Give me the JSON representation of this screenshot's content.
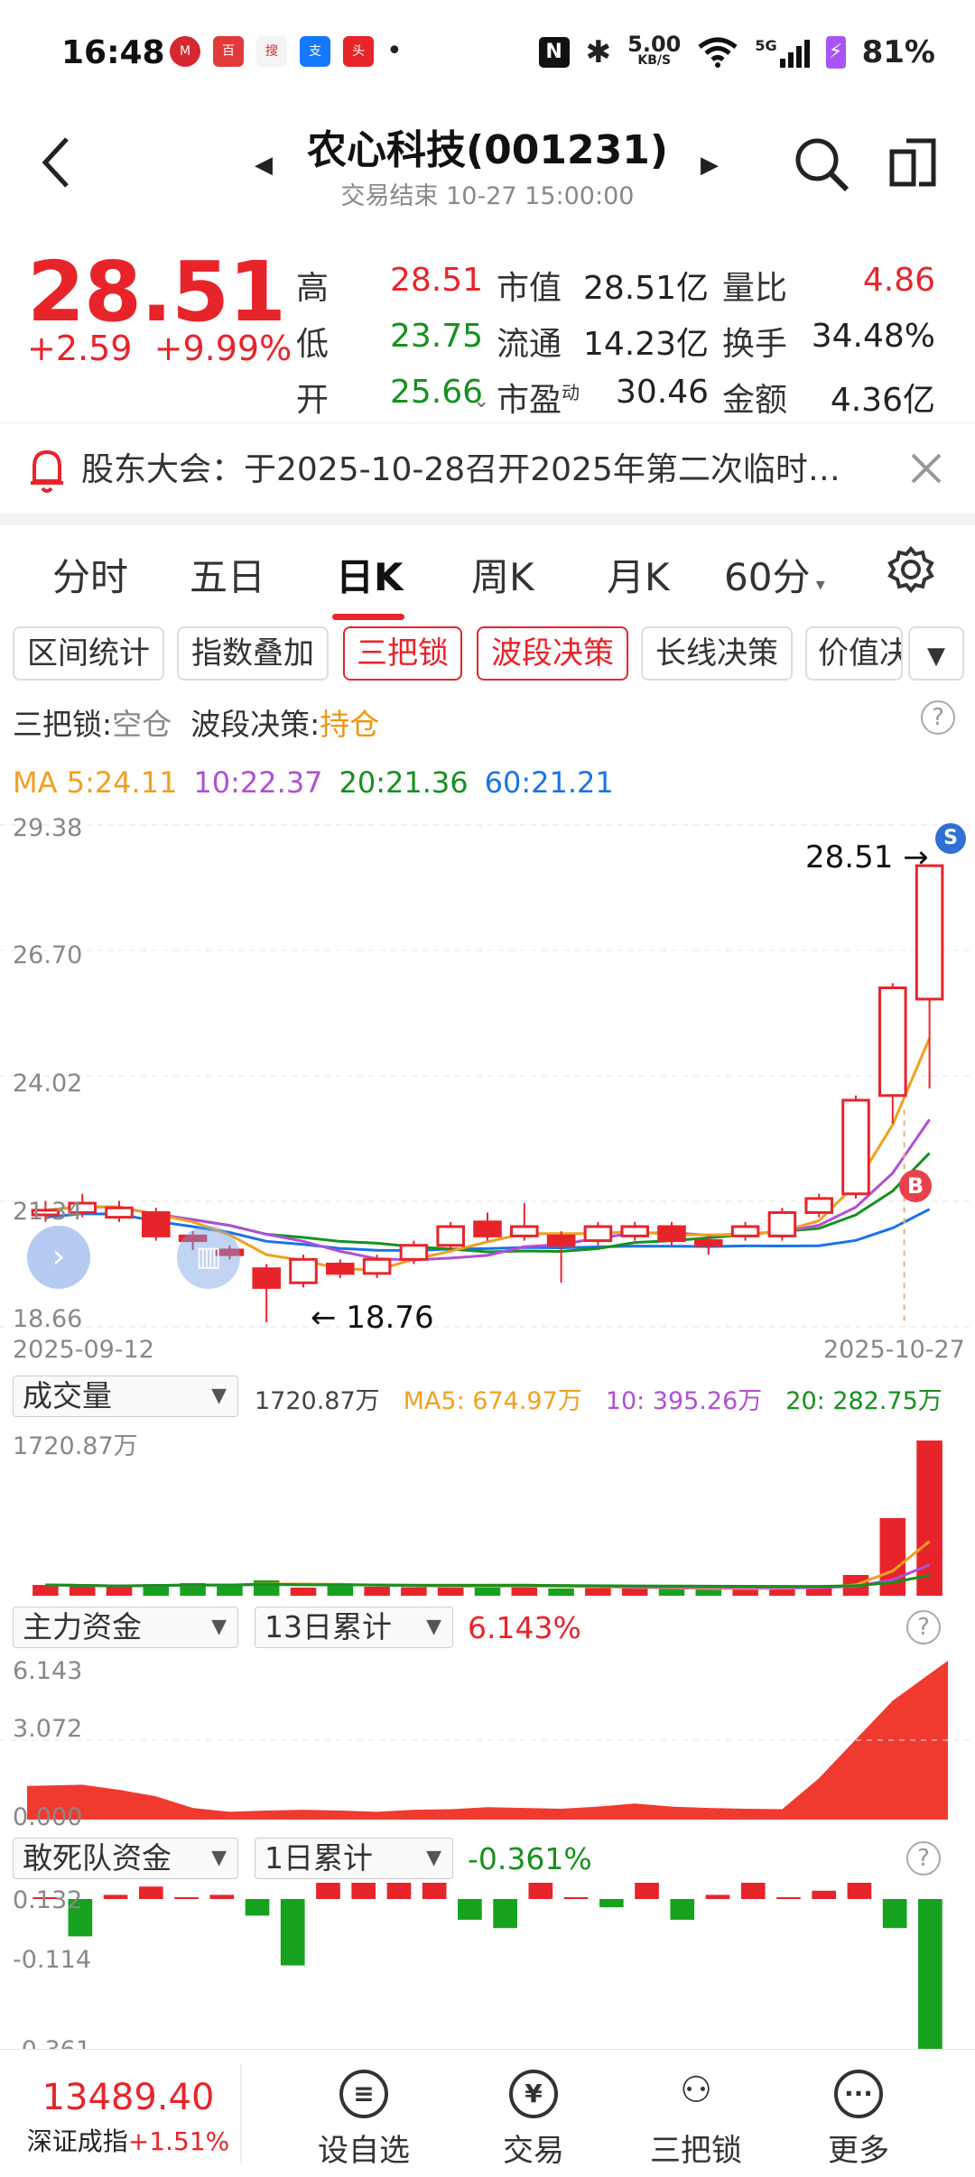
{
  "status_bar": {
    "time": "16:48",
    "net_speed": "5.00",
    "net_unit": "KB/S",
    "signal": "5G",
    "battery": "81%"
  },
  "header": {
    "title": "农心科技(001231)",
    "subtitle": "交易结束 10-27 15:00:00"
  },
  "quote": {
    "price": "28.51",
    "change": "+2.59",
    "change_pct": "+9.99%",
    "stats": [
      {
        "label": "高",
        "value": "28.51",
        "color": "#e8242b"
      },
      {
        "label": "低",
        "value": "23.75",
        "color": "#16911e"
      },
      {
        "label": "开",
        "value": "25.66",
        "color": "#16911e"
      },
      {
        "label": "市值",
        "value": "28.51亿",
        "color": "#222222"
      },
      {
        "label": "流通",
        "value": "14.23亿",
        "color": "#222222"
      },
      {
        "label": "市盈",
        "sup": "动",
        "value": "30.46",
        "color": "#222222"
      },
      {
        "label": "量比",
        "value": "4.86",
        "color": "#e8242b"
      },
      {
        "label": "换手",
        "value": "34.48%",
        "color": "#222222"
      },
      {
        "label": "金额",
        "value": "4.36亿",
        "color": "#222222"
      }
    ]
  },
  "notice": {
    "text": "股东大会：于2025-10-28召开2025年第二次临时…"
  },
  "tabs": [
    "分时",
    "五日",
    "日K",
    "周K",
    "月K",
    "60分"
  ],
  "chips": [
    "区间统计",
    "指数叠加",
    "三把锁",
    "波段决策",
    "长线决策",
    "价值决"
  ],
  "signals": {
    "lock_label": "三把锁:",
    "lock_value": "空仓",
    "wave_label": "波段决策:",
    "wave_value": "持仓"
  },
  "ma": {
    "ma5": "MA 5:24.11",
    "ma10": "10:22.37",
    "ma20": "20:21.36",
    "ma60": "60:21.21"
  },
  "kline": {
    "y_ticks": [
      "29.38",
      "26.70",
      "24.02",
      "21.34",
      "18.66"
    ],
    "x_start": "2025-09-12",
    "x_end": "2025-10-27",
    "high_label": "28.51",
    "low_label": "18.76",
    "mark_b": "B",
    "mark_s": "S"
  },
  "volume": {
    "selector": "成交量",
    "current": "1720.87万",
    "ma5": "MA5: 674.97万",
    "ma10": "10: 395.26万",
    "ma20": "20: 282.75万",
    "y_top": "1720.87万"
  },
  "main_fund": {
    "selector": "主力资金",
    "period": "13日累计",
    "value": "6.143%",
    "y_ticks": [
      "6.143",
      "3.072",
      "0.000"
    ]
  },
  "dare_fund": {
    "selector": "敢死队资金",
    "period": "1日累计",
    "value": "-0.361%",
    "y_ticks": [
      "0.132",
      "-0.114",
      "-0.361"
    ]
  },
  "index": {
    "value": "13489.40",
    "name": "深证成指",
    "pct": "+1.51%"
  },
  "bottom_nav": [
    {
      "label": "设自选",
      "icon": "list-icon"
    },
    {
      "label": "交易",
      "icon": "yen-icon"
    },
    {
      "label": "三把锁",
      "icon": "people-icon"
    },
    {
      "label": "更多",
      "icon": "more-icon"
    }
  ],
  "chart_data": {
    "type": "candlestick",
    "x_range": [
      "2025-09-12",
      "2025-10-27"
    ],
    "ylim": [
      18.66,
      29.38
    ],
    "candles": [
      {
        "o": 21.05,
        "c": 21.15,
        "h": 21.35,
        "l": 20.9
      },
      {
        "o": 21.1,
        "c": 21.3,
        "h": 21.5,
        "l": 21.0
      },
      {
        "o": 21.0,
        "c": 21.2,
        "h": 21.35,
        "l": 20.9
      },
      {
        "o": 21.1,
        "c": 20.6,
        "h": 21.2,
        "l": 20.5
      },
      {
        "o": 20.6,
        "c": 20.5,
        "h": 20.7,
        "l": 20.3
      },
      {
        "o": 20.3,
        "c": 20.2,
        "h": 20.4,
        "l": 20.1
      },
      {
        "o": 19.9,
        "c": 19.5,
        "h": 20.0,
        "l": 18.76
      },
      {
        "o": 19.6,
        "c": 20.1,
        "h": 20.2,
        "l": 19.5
      },
      {
        "o": 20.0,
        "c": 19.8,
        "h": 20.1,
        "l": 19.7
      },
      {
        "o": 19.8,
        "c": 20.1,
        "h": 20.2,
        "l": 19.7
      },
      {
        "o": 20.1,
        "c": 20.4,
        "h": 20.5,
        "l": 20.0
      },
      {
        "o": 20.4,
        "c": 20.8,
        "h": 20.9,
        "l": 20.3
      },
      {
        "o": 20.9,
        "c": 20.6,
        "h": 21.1,
        "l": 20.5
      },
      {
        "o": 20.6,
        "c": 20.8,
        "h": 21.3,
        "l": 20.5
      },
      {
        "o": 20.6,
        "c": 20.4,
        "h": 20.7,
        "l": 19.6
      },
      {
        "o": 20.5,
        "c": 20.8,
        "h": 20.9,
        "l": 20.4
      },
      {
        "o": 20.6,
        "c": 20.8,
        "h": 20.9,
        "l": 20.5
      },
      {
        "o": 20.8,
        "c": 20.5,
        "h": 20.9,
        "l": 20.4
      },
      {
        "o": 20.5,
        "c": 20.4,
        "h": 20.6,
        "l": 20.2
      },
      {
        "o": 20.6,
        "c": 20.8,
        "h": 20.9,
        "l": 20.5
      },
      {
        "o": 20.6,
        "c": 21.1,
        "h": 21.2,
        "l": 20.5
      },
      {
        "o": 21.1,
        "c": 21.4,
        "h": 21.5,
        "l": 21.0
      },
      {
        "o": 21.5,
        "c": 23.5,
        "h": 23.6,
        "l": 21.4
      },
      {
        "o": 23.6,
        "c": 25.9,
        "h": 26.0,
        "l": 23.0
      },
      {
        "o": 25.66,
        "c": 28.51,
        "h": 28.51,
        "l": 23.75
      }
    ],
    "volume": [
      120,
      110,
      95,
      130,
      140,
      120,
      170,
      90,
      115,
      100,
      95,
      110,
      105,
      125,
      80,
      85,
      70,
      75,
      90,
      80,
      95,
      110,
      230,
      860,
      1720.87
    ],
    "main_fund": [
      1.3,
      1.35,
      1.15,
      0.9,
      0.45,
      0.3,
      0.35,
      0.38,
      0.35,
      0.3,
      0.38,
      0.4,
      0.48,
      0.45,
      0.42,
      0.5,
      0.62,
      0.5,
      0.45,
      0.42,
      0.4,
      1.6,
      3.1,
      4.6,
      6.143
    ],
    "dare_fund": [
      0.0,
      -0.09,
      0.01,
      0.03,
      0.0,
      0.01,
      -0.04,
      -0.16,
      0.132,
      0.05,
      0.06,
      0.09,
      -0.05,
      -0.07,
      0.04,
      0.0,
      -0.02,
      0.13,
      -0.05,
      0.01,
      0.07,
      0.0,
      0.02,
      0.04,
      -0.07,
      -0.361
    ]
  }
}
